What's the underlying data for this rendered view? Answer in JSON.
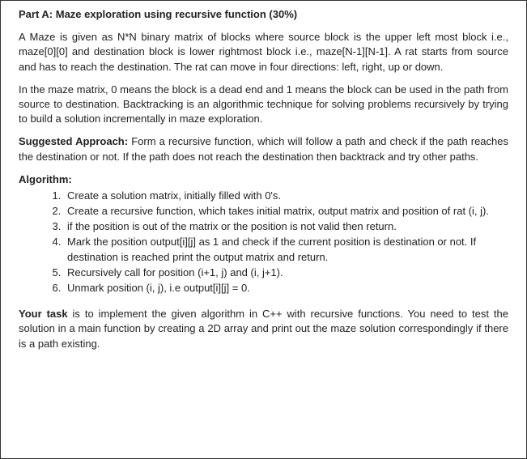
{
  "doc": {
    "title": "Part A: Maze exploration using recursive function (30%)",
    "para1": "A Maze is given as N*N binary matrix of blocks where source block is the upper left most block i.e., maze[0][0] and destination block is lower rightmost block i.e., maze[N-1][N-1]. A rat starts from source and has to reach the destination. The rat can move in four directions: left, right, up or down.",
    "para2": "In the maze matrix, 0 means the block is a dead end and 1 means the block can be used in the path from source to destination.  Backtracking is an algorithmic technique for solving problems recursively by trying to build a solution incrementally in maze exploration.",
    "suggested_label": "Suggested Approach:",
    "suggested_text": " Form a recursive function, which will follow a path and check if the path reaches the destination or not. If the path does not reach the destination then backtrack and try other paths.",
    "algo_heading": "Algorithm:",
    "algo_steps": [
      "Create a solution matrix, initially filled with 0's.",
      "Create a recursive function, which takes initial matrix, output matrix and position of rat (i, j).",
      "if the position is out of the matrix or the position is not valid then return.",
      "Mark the position output[i][j] as 1 and check if the current position is destination or not. If destination is reached print the output matrix and return.",
      "Recursively call for position (i+1, j) and (i, j+1).",
      "Unmark position (i, j), i.e output[i][j] = 0."
    ],
    "task_label": "Your task",
    "task_text": " is to implement the given algorithm in C++ with recursive functions. You need to test the solution in a main function by creating a 2D array and print out the maze solution correspondingly if there is a path existing."
  }
}
